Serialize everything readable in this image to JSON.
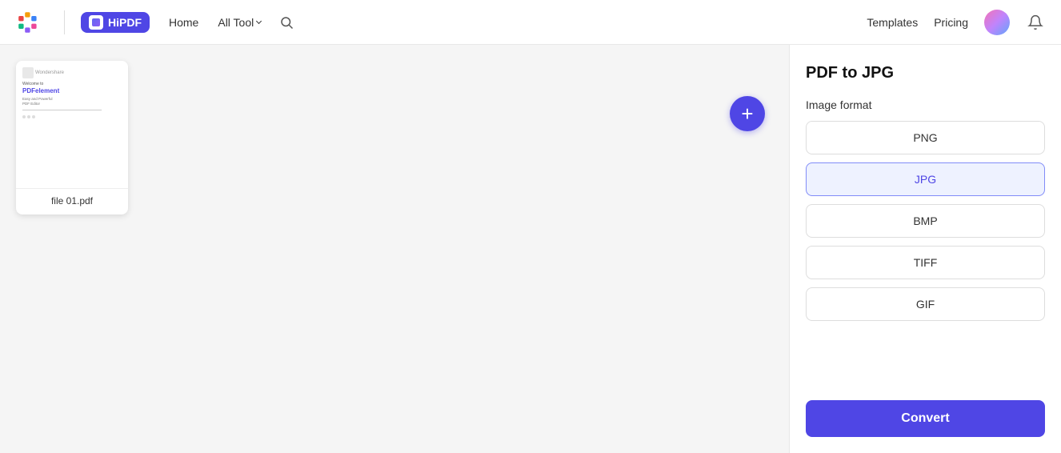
{
  "header": {
    "brand": "Wondershare",
    "app_name": "HiPDF",
    "nav": {
      "home_label": "Home",
      "all_tool_label": "All Tool",
      "templates_label": "Templates",
      "pricing_label": "Pricing"
    }
  },
  "file_card": {
    "filename": "file 01.pdf",
    "preview_brand": "Wondershare",
    "preview_welcome": "Welcome to",
    "preview_product": "PDFelement",
    "preview_sub1": "Easy and Powerful",
    "preview_sub2": "PDF Editor"
  },
  "right_panel": {
    "title": "PDF to JPG",
    "image_format_label": "Image format",
    "formats": [
      {
        "id": "png",
        "label": "PNG",
        "selected": false
      },
      {
        "id": "jpg",
        "label": "JPG",
        "selected": true
      },
      {
        "id": "bmp",
        "label": "BMP",
        "selected": false
      },
      {
        "id": "tiff",
        "label": "TIFF",
        "selected": false
      },
      {
        "id": "gif",
        "label": "GIF",
        "selected": false
      }
    ],
    "convert_label": "Convert"
  },
  "add_button_label": "+"
}
